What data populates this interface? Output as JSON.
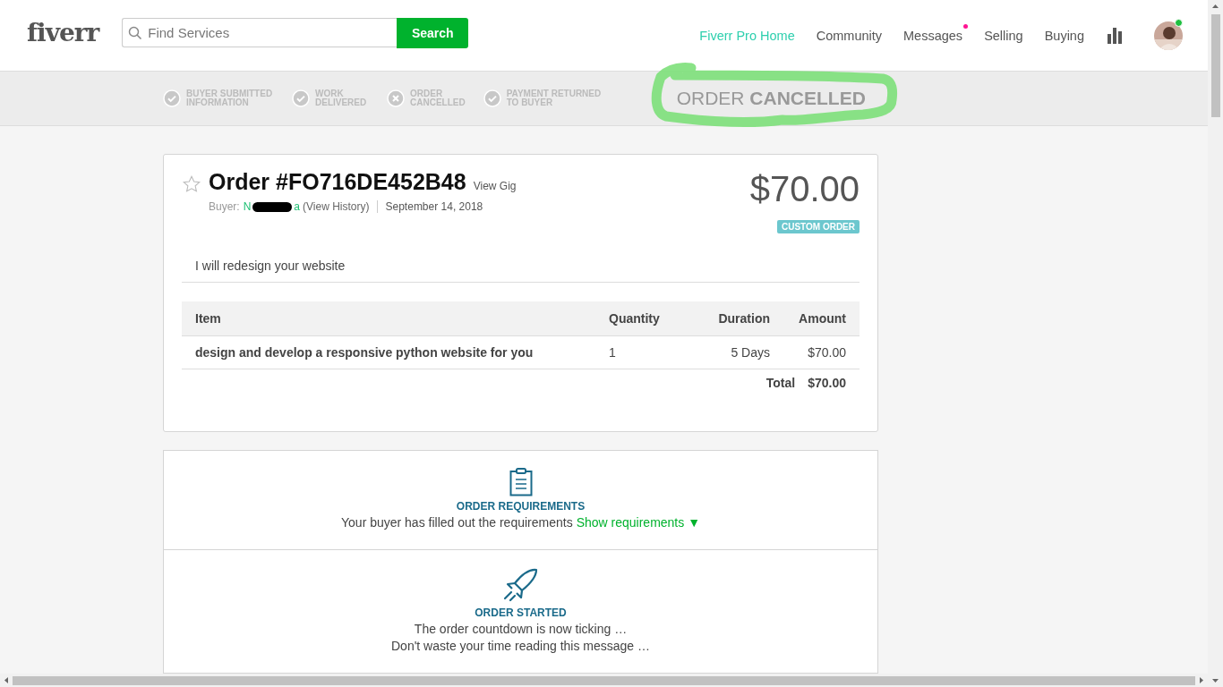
{
  "header": {
    "logo": "fiverr",
    "search": {
      "placeholder": "Find Services",
      "button": "Search"
    },
    "nav": [
      {
        "label": "Fiverr Pro Home",
        "selected": true,
        "notification": false
      },
      {
        "label": "Community",
        "selected": false,
        "notification": false
      },
      {
        "label": "Messages",
        "selected": false,
        "notification": true
      },
      {
        "label": "Selling",
        "selected": false,
        "notification": false
      },
      {
        "label": "Buying",
        "selected": false,
        "notification": false
      }
    ],
    "user_online": true
  },
  "progress": {
    "steps": [
      {
        "kind": "check",
        "label": "BUYER SUBMITTED INFORMATION"
      },
      {
        "kind": "check",
        "label": "WORK DELIVERED"
      },
      {
        "kind": "cross",
        "label": "ORDER CANCELLED"
      },
      {
        "kind": "check",
        "label": "PAYMENT RETURNED TO BUYER"
      }
    ],
    "status": "ORDER **CANCELLED**"
  },
  "order": {
    "title": "Order #FO716DE452B48",
    "view_gig": "View Gig",
    "buyer_label": "Buyer:",
    "buyer_name_start": "N",
    "buyer_name_end": "a",
    "view_history": "(View History)",
    "date": "September 14, 2018",
    "price": "$70.00",
    "badge": "CUSTOM ORDER",
    "description": "I will redesign your website",
    "table": {
      "columns": [
        "Item",
        "Quantity",
        "Duration",
        "Amount"
      ],
      "rows": [
        [
          "design and develop a responsive python website for you",
          "1",
          "5 Days",
          "$70.00"
        ]
      ],
      "total_label": "Total",
      "total": "$70.00"
    }
  },
  "events": [
    {
      "kind": "requirements",
      "title": "ORDER REQUIREMENTS",
      "lines": [
        "Your buyer has filled out the requirements"
      ],
      "link": "Show requirements ▼"
    },
    {
      "kind": "started",
      "title": "ORDER STARTED",
      "lines": [
        "The order countdown is now ticking …",
        "Don't waste your time reading this message …"
      ]
    }
  ]
}
